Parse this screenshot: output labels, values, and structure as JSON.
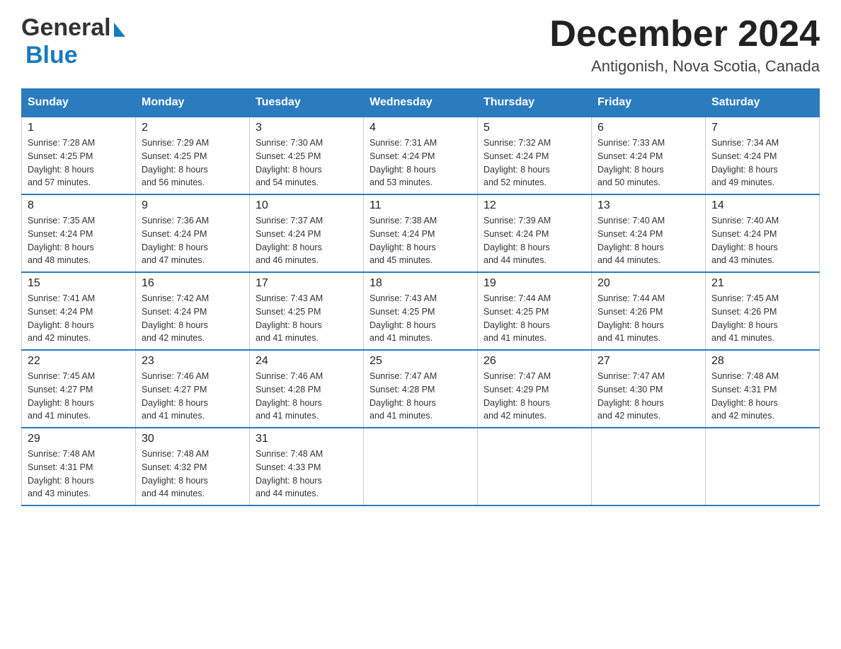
{
  "header": {
    "month_year": "December 2024",
    "location": "Antigonish, Nova Scotia, Canada",
    "logo_general": "General",
    "logo_blue": "Blue"
  },
  "weekdays": [
    "Sunday",
    "Monday",
    "Tuesday",
    "Wednesday",
    "Thursday",
    "Friday",
    "Saturday"
  ],
  "weeks": [
    [
      {
        "day": "1",
        "sunrise": "7:28 AM",
        "sunset": "4:25 PM",
        "daylight": "8 hours and 57 minutes."
      },
      {
        "day": "2",
        "sunrise": "7:29 AM",
        "sunset": "4:25 PM",
        "daylight": "8 hours and 56 minutes."
      },
      {
        "day": "3",
        "sunrise": "7:30 AM",
        "sunset": "4:25 PM",
        "daylight": "8 hours and 54 minutes."
      },
      {
        "day": "4",
        "sunrise": "7:31 AM",
        "sunset": "4:24 PM",
        "daylight": "8 hours and 53 minutes."
      },
      {
        "day": "5",
        "sunrise": "7:32 AM",
        "sunset": "4:24 PM",
        "daylight": "8 hours and 52 minutes."
      },
      {
        "day": "6",
        "sunrise": "7:33 AM",
        "sunset": "4:24 PM",
        "daylight": "8 hours and 50 minutes."
      },
      {
        "day": "7",
        "sunrise": "7:34 AM",
        "sunset": "4:24 PM",
        "daylight": "8 hours and 49 minutes."
      }
    ],
    [
      {
        "day": "8",
        "sunrise": "7:35 AM",
        "sunset": "4:24 PM",
        "daylight": "8 hours and 48 minutes."
      },
      {
        "day": "9",
        "sunrise": "7:36 AM",
        "sunset": "4:24 PM",
        "daylight": "8 hours and 47 minutes."
      },
      {
        "day": "10",
        "sunrise": "7:37 AM",
        "sunset": "4:24 PM",
        "daylight": "8 hours and 46 minutes."
      },
      {
        "day": "11",
        "sunrise": "7:38 AM",
        "sunset": "4:24 PM",
        "daylight": "8 hours and 45 minutes."
      },
      {
        "day": "12",
        "sunrise": "7:39 AM",
        "sunset": "4:24 PM",
        "daylight": "8 hours and 44 minutes."
      },
      {
        "day": "13",
        "sunrise": "7:40 AM",
        "sunset": "4:24 PM",
        "daylight": "8 hours and 44 minutes."
      },
      {
        "day": "14",
        "sunrise": "7:40 AM",
        "sunset": "4:24 PM",
        "daylight": "8 hours and 43 minutes."
      }
    ],
    [
      {
        "day": "15",
        "sunrise": "7:41 AM",
        "sunset": "4:24 PM",
        "daylight": "8 hours and 42 minutes."
      },
      {
        "day": "16",
        "sunrise": "7:42 AM",
        "sunset": "4:24 PM",
        "daylight": "8 hours and 42 minutes."
      },
      {
        "day": "17",
        "sunrise": "7:43 AM",
        "sunset": "4:25 PM",
        "daylight": "8 hours and 41 minutes."
      },
      {
        "day": "18",
        "sunrise": "7:43 AM",
        "sunset": "4:25 PM",
        "daylight": "8 hours and 41 minutes."
      },
      {
        "day": "19",
        "sunrise": "7:44 AM",
        "sunset": "4:25 PM",
        "daylight": "8 hours and 41 minutes."
      },
      {
        "day": "20",
        "sunrise": "7:44 AM",
        "sunset": "4:26 PM",
        "daylight": "8 hours and 41 minutes."
      },
      {
        "day": "21",
        "sunrise": "7:45 AM",
        "sunset": "4:26 PM",
        "daylight": "8 hours and 41 minutes."
      }
    ],
    [
      {
        "day": "22",
        "sunrise": "7:45 AM",
        "sunset": "4:27 PM",
        "daylight": "8 hours and 41 minutes."
      },
      {
        "day": "23",
        "sunrise": "7:46 AM",
        "sunset": "4:27 PM",
        "daylight": "8 hours and 41 minutes."
      },
      {
        "day": "24",
        "sunrise": "7:46 AM",
        "sunset": "4:28 PM",
        "daylight": "8 hours and 41 minutes."
      },
      {
        "day": "25",
        "sunrise": "7:47 AM",
        "sunset": "4:28 PM",
        "daylight": "8 hours and 41 minutes."
      },
      {
        "day": "26",
        "sunrise": "7:47 AM",
        "sunset": "4:29 PM",
        "daylight": "8 hours and 42 minutes."
      },
      {
        "day": "27",
        "sunrise": "7:47 AM",
        "sunset": "4:30 PM",
        "daylight": "8 hours and 42 minutes."
      },
      {
        "day": "28",
        "sunrise": "7:48 AM",
        "sunset": "4:31 PM",
        "daylight": "8 hours and 42 minutes."
      }
    ],
    [
      {
        "day": "29",
        "sunrise": "7:48 AM",
        "sunset": "4:31 PM",
        "daylight": "8 hours and 43 minutes."
      },
      {
        "day": "30",
        "sunrise": "7:48 AM",
        "sunset": "4:32 PM",
        "daylight": "8 hours and 44 minutes."
      },
      {
        "day": "31",
        "sunrise": "7:48 AM",
        "sunset": "4:33 PM",
        "daylight": "8 hours and 44 minutes."
      },
      null,
      null,
      null,
      null
    ]
  ],
  "labels": {
    "sunrise": "Sunrise:",
    "sunset": "Sunset:",
    "daylight": "Daylight:"
  }
}
